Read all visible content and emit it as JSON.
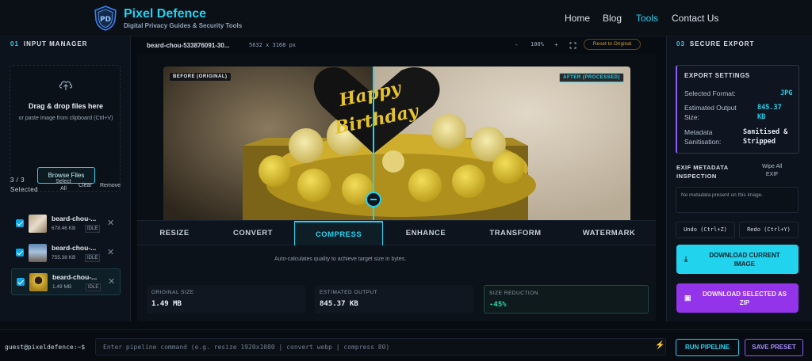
{
  "header": {
    "logo_text": "PD",
    "brand_name": "Pixel Defence",
    "brand_tagline": "Digital Privacy Guides & Security Tools",
    "nav": [
      {
        "label": "Home",
        "active": false
      },
      {
        "label": "Blog",
        "active": false
      },
      {
        "label": "Tools",
        "active": true
      },
      {
        "label": "Contact Us",
        "active": false
      }
    ]
  },
  "input_manager": {
    "number": "01",
    "title": "INPUT MANAGER",
    "drop_title": "Drag & drop files here",
    "drop_subtitle": "or paste image from clipboard (Ctrl+V)",
    "browse_label": "Browse Files",
    "selected_count": "3 / 3",
    "selected_label": "Selected",
    "select_all": "Select All",
    "clear": "Clear",
    "remove": "Remove",
    "files": [
      {
        "name": "beard-chou-...",
        "size": "678.46 KB",
        "status": "IDLE",
        "checked": true,
        "active": false
      },
      {
        "name": "beard-chou-...",
        "size": "755.38 KB",
        "status": "IDLE",
        "checked": true,
        "active": false
      },
      {
        "name": "beard-chou-...",
        "size": "1.49 MB",
        "status": "IDLE",
        "checked": true,
        "active": true
      }
    ]
  },
  "editor": {
    "file_name": "beard-chou-533876091-30...",
    "dimensions": "5632 x 3168 px",
    "zoom_out": "-",
    "zoom_level": "100%",
    "zoom_in": "+",
    "fit_icon": "fit-screen-icon",
    "reset_label": "Reset to Original",
    "before_label": "BEFORE (ORIGINAL)",
    "after_label": "AFTER (PROCESSED)",
    "cake_topper_line1": "Happy",
    "cake_topper_line2": "Birthday",
    "tabs": [
      "RESIZE",
      "CONVERT",
      "COMPRESS",
      "ENHANCE",
      "TRANSFORM",
      "WATERMARK"
    ],
    "active_tab": "COMPRESS",
    "hint": "Auto-calculates quality to achieve target size in bytes.",
    "stats": [
      {
        "label": "ORIGINAL SIZE",
        "value": "1.49 MB"
      },
      {
        "label": "ESTIMATED OUTPUT",
        "value": "845.37 KB"
      },
      {
        "label": "SIZE REDUCTION",
        "value": "-45%"
      }
    ]
  },
  "secure_export": {
    "number": "03",
    "title": "SECURE EXPORT",
    "settings_title": "EXPORT SETTINGS",
    "format_label": "Selected Format:",
    "format_value": "JPG",
    "output_label_1": "Estimated Output",
    "output_label_2": "Size:",
    "output_value_1": "845.37",
    "output_value_2": "KB",
    "meta_label_1": "Metadata",
    "meta_label_2": "Sanitisation:",
    "meta_value_1": "Sanitised &",
    "meta_value_2": "Stripped",
    "exif_title_1": "EXIF METADATA",
    "exif_title_2": "INSPECTION",
    "wipe_1": "Wipe All",
    "wipe_2": "EXIF",
    "exif_empty": "No metadata present on this image.",
    "undo": "Undo (Ctrl+Z)",
    "redo": "Redo (Ctrl+Y)",
    "download_current_1": "DOWNLOAD CURRENT",
    "download_current_2": "IMAGE",
    "download_zip_1": "DOWNLOAD SELECTED AS",
    "download_zip_2": "ZIP",
    "colors": {
      "cyan": "#22d3ee",
      "purple": "#9333ea"
    }
  },
  "bottom": {
    "prompt": "guest@pixeldefence:~$",
    "command_placeholder": "Enter pipeline command (e.g. resize 1920x1080 | convert webp | compress 80)",
    "run": "RUN PIPELINE",
    "save": "SAVE PRESET"
  }
}
